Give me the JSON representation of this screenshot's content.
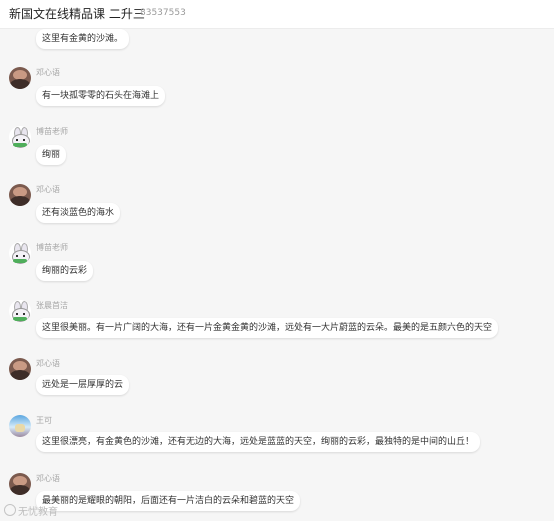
{
  "header": {
    "title": "新国文在线精品课 二升三",
    "room_id": "83537553"
  },
  "messages": [
    {
      "sender": "",
      "avatar": "none",
      "text": "这里有金黄的沙滩。"
    },
    {
      "sender": "邓心语",
      "avatar": "photo",
      "text": "有一块孤零零的石头在海滩上"
    },
    {
      "sender": "博苗老师",
      "avatar": "rabbit",
      "text": "绚丽"
    },
    {
      "sender": "邓心语",
      "avatar": "photo",
      "text": "还有淡蓝色的海水"
    },
    {
      "sender": "博苗老师",
      "avatar": "rabbit",
      "text": "绚丽的云彩"
    },
    {
      "sender": "张晨首洁",
      "avatar": "rabbit",
      "text": "这里很美丽。有一片广阔的大海，还有一片金黄金黄的沙滩，远处有一大片蔚蓝的云朵。最美的是五颜六色的天空"
    },
    {
      "sender": "邓心语",
      "avatar": "photo",
      "text": "远处是一层厚厚的云"
    },
    {
      "sender": "王可",
      "avatar": "sky",
      "text": "这里很漂亮，有金黄色的沙滩，还有无边的大海，远处是蓝蓝的天空，绚丽的云彩，最独特的是中间的山丘！"
    },
    {
      "sender": "邓心语",
      "avatar": "photo",
      "text": "最美丽的是耀眼的朝阳，后面还有一片洁白的云朵和碧蓝的天空"
    }
  ],
  "watermark": "无忧教育",
  "colors": {
    "background": "#f6f6f6",
    "bubble": "#ffffff",
    "name_text": "#a6a6a6"
  }
}
